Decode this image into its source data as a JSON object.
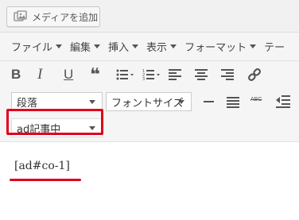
{
  "media_button": {
    "label": "メディアを追加",
    "icon": "media-icon"
  },
  "menubar": {
    "items": [
      "ファイル",
      "編集",
      "挿入",
      "表示",
      "フォーマット",
      "テー"
    ]
  },
  "toolbar_row1": {
    "buttons": [
      {
        "name": "bold-button",
        "glyph": "B"
      },
      {
        "name": "italic-button",
        "glyph": "I"
      },
      {
        "name": "underline-button",
        "glyph": "U"
      },
      {
        "name": "blockquote-button",
        "glyph": "❝"
      },
      {
        "name": "bullet-list-button",
        "glyph": "☰"
      },
      {
        "name": "numbered-list-button",
        "glyph": "☰"
      },
      {
        "name": "align-left-button",
        "glyph": "≡"
      },
      {
        "name": "align-center-button",
        "glyph": "≡"
      },
      {
        "name": "align-right-button",
        "glyph": "≡"
      },
      {
        "name": "link-button",
        "glyph": "🔗"
      }
    ]
  },
  "toolbar_row2": {
    "paragraph_select": "段落",
    "font_size_select": "フォントサイズ",
    "strikethrough_label": "ABC"
  },
  "toolbar_row3": {
    "ad_select": "ad記事中"
  },
  "content": {
    "shortcode": "[ad#co-1]"
  },
  "colors": {
    "highlight": "#e0001b"
  }
}
